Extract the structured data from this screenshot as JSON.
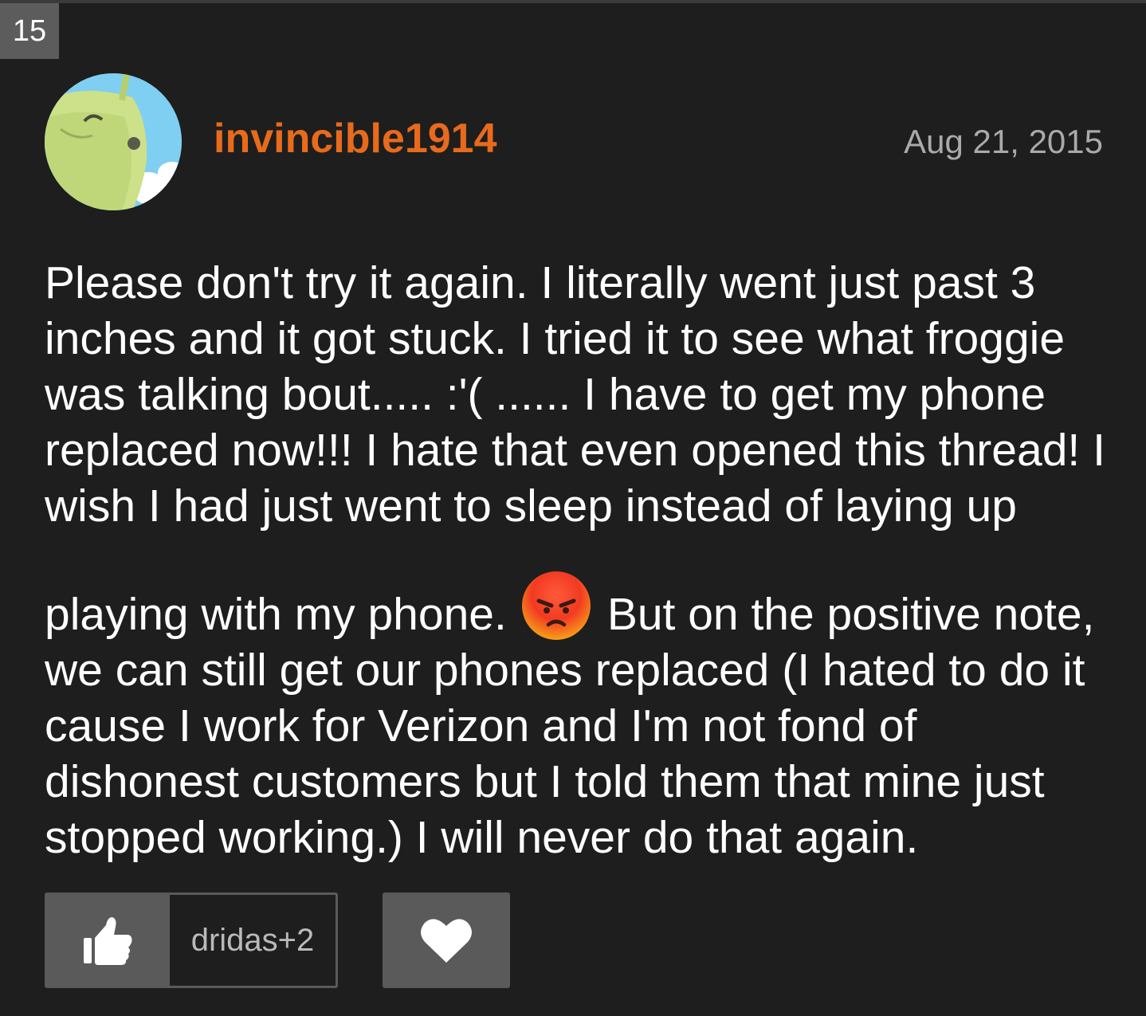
{
  "post": {
    "number": "15",
    "author": "invincible1914",
    "date": "Aug 21, 2015",
    "body_part1": "Please don't try it again. I literally went just past 3 inches and it got stuck. I tried it to see what froggie was talking bout..... :'( ...... I have to get my phone replaced now!!! I hate that even opened this thread! I wish I had just went to sleep instead of laying up",
    "body_part2_before_emoji": "playing with my phone.",
    "emoji": "angry-face-icon",
    "body_part2_after_emoji": "But on the positive note, we can still get our phones replaced (I hated to do it cause I work for Verizon and I'm not fond of dishonest customers but I told them that mine just stopped working.) I will never do that again."
  },
  "actions": {
    "like_icon": "thumbs-up-icon",
    "like_text": "dridas+2",
    "heart_icon": "heart-icon"
  },
  "colors": {
    "background": "#1d1e1d",
    "username": "#e86a1c",
    "date": "#a9aaa9",
    "button": "#595a59"
  }
}
